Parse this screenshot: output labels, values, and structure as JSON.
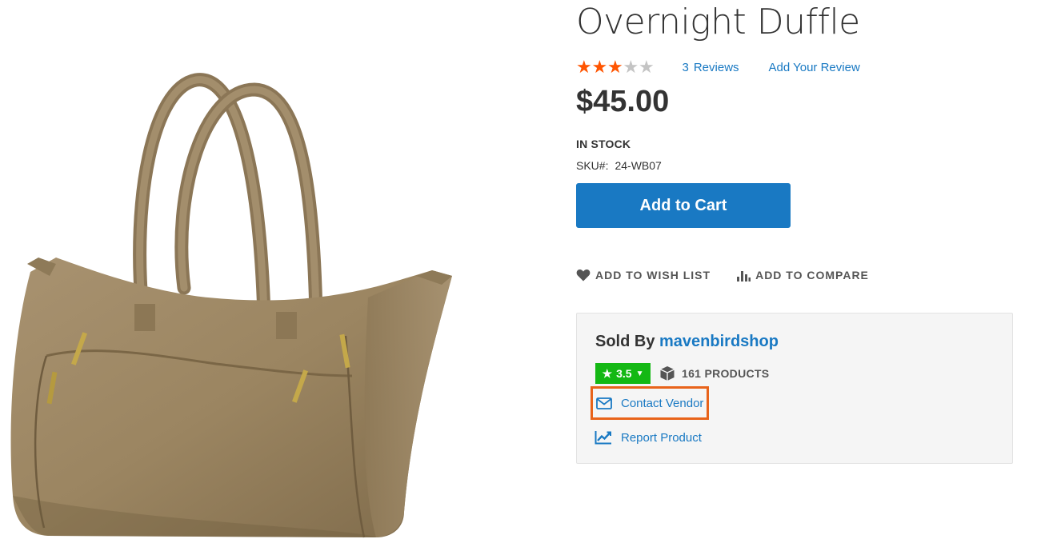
{
  "product": {
    "title": "Overnight Duffle",
    "rating_stars_filled": 3,
    "rating_stars_total": 5,
    "reviews_count": "3",
    "reviews_label": "Reviews",
    "add_review_label": "Add Your Review",
    "price": "$45.00",
    "stock": "IN STOCK",
    "sku_label": "SKU#:",
    "sku_value": "24-WB07",
    "add_to_cart": "Add to Cart",
    "wishlist_label": "ADD TO WISH LIST",
    "compare_label": "ADD TO COMPARE",
    "image_icon": "duffle-bag-photo"
  },
  "vendor": {
    "sold_by_label": "Sold By",
    "name": "mavenbirdshop",
    "rating": "3.5",
    "products_count": "161 PRODUCTS",
    "contact_label": "Contact Vendor",
    "report_label": "Report Product"
  },
  "colors": {
    "accent": "#1979c3",
    "star_on": "#ff5501",
    "star_off": "#c4c4c4",
    "rating_badge": "#14b814",
    "highlight_border": "#e8631a",
    "vendor_box_bg": "#f5f5f5"
  }
}
